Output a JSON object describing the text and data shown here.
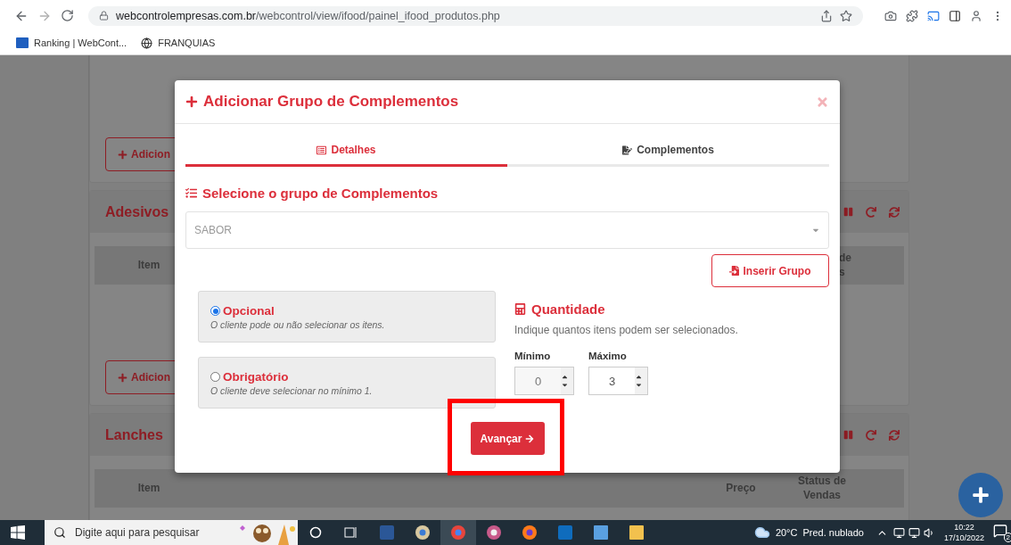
{
  "browser": {
    "url_host": "webcontrolempresas.com.br",
    "url_path": "/webcontrol/view/ifood/painel_ifood_produtos.php",
    "bookmarks": [
      {
        "kind": "logo",
        "label": "Ranking | WebCont..."
      },
      {
        "kind": "globe",
        "label": "FRANQUIAS"
      }
    ]
  },
  "page": {
    "sections": [
      {
        "kind": "button",
        "button": "Adicion"
      },
      {
        "kind": "table",
        "title": "Adesivos",
        "columns": [
          {
            "kind": "item",
            "label": "Item"
          },
          {
            "kind": "partial",
            "lines": [
              "de",
              "s"
            ]
          }
        ],
        "button": "Adicion"
      },
      {
        "kind": "table",
        "title": "Lanches",
        "columns": [
          {
            "kind": "item",
            "label": "Item"
          },
          {
            "kind": "price",
            "label": "Preço"
          },
          {
            "kind": "status",
            "lines": [
              "Status de",
              "Vendas"
            ]
          }
        ]
      }
    ]
  },
  "modal": {
    "title": "Adicionar Grupo de Complementos",
    "tabs": [
      {
        "label": "Detalhes",
        "selected": true
      },
      {
        "label": "Complementos",
        "selected": false
      }
    ],
    "section_title": "Selecione o grupo de Complementos",
    "select": {
      "placeholder": "SABOR"
    },
    "insert_button": "Inserir Grupo",
    "options": [
      {
        "label": "Opcional",
        "description": "O cliente pode ou não selecionar os itens.",
        "selected": true
      },
      {
        "label": "Obrigatório",
        "description": "O cliente deve selecionar no mínimo 1.",
        "selected": false
      }
    ],
    "quantity": {
      "title": "Quantidade",
      "hint": "Indique quantos itens podem ser selecionados.",
      "fields": [
        {
          "label": "Mínimo",
          "value": "0",
          "disabled": true
        },
        {
          "label": "Máximo",
          "value": "3",
          "disabled": false
        }
      ]
    },
    "submit": "Avançar"
  },
  "taskbar": {
    "search_placeholder": "Digite aqui para pesquisar",
    "temperature": "20°C",
    "weather": "Pred. nublado",
    "time": "10:22",
    "date": "17/10/2022",
    "notifications": "2"
  }
}
